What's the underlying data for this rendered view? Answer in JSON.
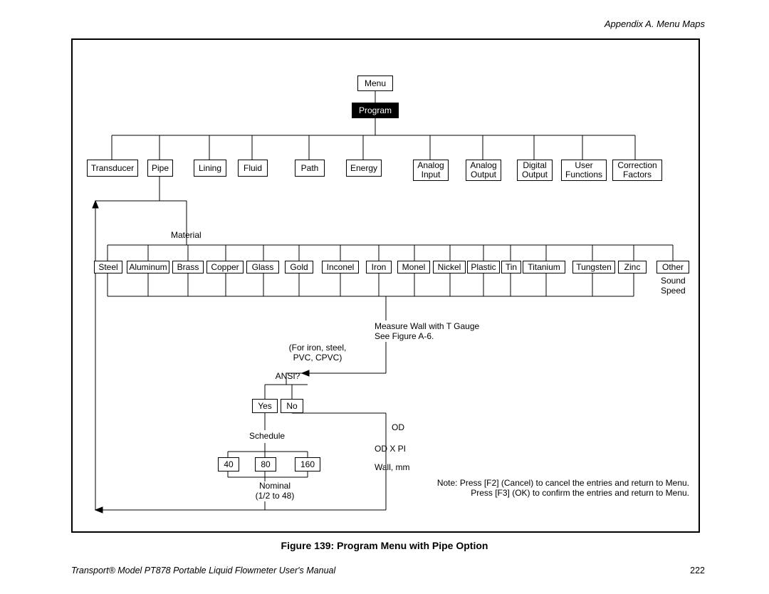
{
  "header": {
    "appendix": "Appendix A. Menu Maps"
  },
  "caption": "Figure 139:  Program Menu with Pipe Option",
  "footer": {
    "left": "Transport® Model PT878 Portable Liquid Flowmeter User's Manual",
    "right": "222"
  },
  "root": {
    "menu": "Menu",
    "program": "Program"
  },
  "row1": {
    "transducer": "Transducer",
    "pipe": "Pipe",
    "lining": "Lining",
    "fluid": "Fluid",
    "path": "Path",
    "energy": "Energy",
    "analog_input": "Analog\nInput",
    "analog_output": "Analog\nOutput",
    "digital_output": "Digital\nOutput",
    "user_functions": "User\nFunctions",
    "correction_factors": "Correction\nFactors"
  },
  "material_label": "Material",
  "materials": {
    "steel": "Steel",
    "aluminum": "Aluminum",
    "brass": "Brass",
    "copper": "Copper",
    "glass": "Glass",
    "gold": "Gold",
    "inconel": "Inconel",
    "iron": "Iron",
    "monel": "Monel",
    "nickel": "Nickel",
    "plastic": "Plastic",
    "tin": "Tin",
    "titanium": "Titanium",
    "tungsten": "Tungsten",
    "zinc": "Zinc",
    "other": "Other"
  },
  "sound_speed": "Sound\nSpeed",
  "measure_wall": "Measure Wall with T Gauge\nSee Figure A-6.",
  "for_iron": "(For iron, steel,\nPVC, CPVC)",
  "ansi": "ANSI?",
  "yes": "Yes",
  "no": "No",
  "schedule": "Schedule",
  "sched": {
    "s40": "40",
    "s80": "80",
    "s160": "160"
  },
  "nominal": "Nominal\n(1/2 to 48)",
  "od": "OD",
  "odxpi": "OD X PI",
  "wall": "Wall, mm",
  "note": "Note: Press [F2] (Cancel) to cancel the entries and return to Menu.\nPress [F3] (OK) to confirm the entries and return to Menu."
}
